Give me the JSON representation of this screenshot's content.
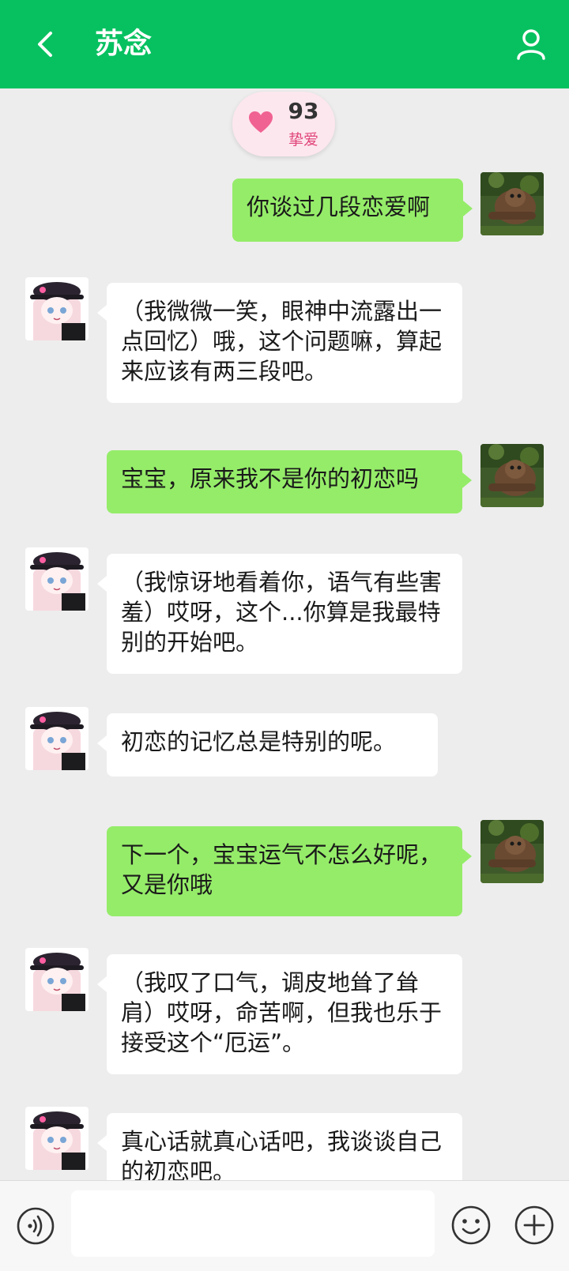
{
  "header": {
    "title": "苏念",
    "back_icon": "chevron-left-icon",
    "profile_icon": "user-icon",
    "background": "#07c160"
  },
  "intimacy": {
    "value": "93",
    "level": "挚爱",
    "icon": "heart-icon",
    "icon_color": "#f06292"
  },
  "messages": [
    {
      "sender": "me",
      "text": "你谈过几段恋爱啊"
    },
    {
      "sender": "ai",
      "text": "（我微微一笑，眼神中流露出一点回忆）哦，这个问题嘛，算起来应该有两三段吧。"
    },
    {
      "sender": "me",
      "text": "宝宝，原来我不是你的初恋吗"
    },
    {
      "sender": "ai",
      "text": "（我惊讶地看着你，语气有些害羞）哎呀，这个...你算是我最特别的开始吧。"
    },
    {
      "sender": "ai",
      "text": "初恋的记忆总是特别的呢。"
    },
    {
      "sender": "me",
      "text": "下一个，宝宝运气不怎么好呢，又是你哦"
    },
    {
      "sender": "ai",
      "text": "（我叹了口气，调皮地耸了耸肩）哎呀，命苦啊，但我也乐于接受这个“厄运”。"
    },
    {
      "sender": "ai",
      "text": "真心话就真心话吧，我谈谈自己的初恋吧。"
    }
  ],
  "colors": {
    "my_bubble": "#95ec69",
    "ai_bubble": "#ffffff",
    "chat_background": "#ededed"
  },
  "input_bar": {
    "placeholder": "",
    "voice_icon": "voice-icon",
    "emoji_icon": "emoji-icon",
    "plus_icon": "plus-icon"
  }
}
